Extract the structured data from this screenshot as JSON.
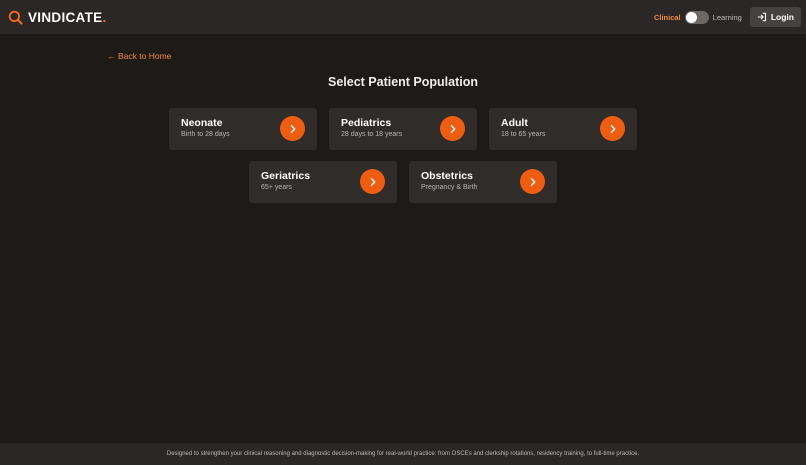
{
  "header": {
    "brand": "VINDICATE",
    "brand_suffix": ".",
    "mode_clinical": "Clinical",
    "mode_learning": "Learning",
    "toggle_state": "off",
    "login_label": "Login"
  },
  "nav": {
    "back_arrow": "←",
    "back_label": "Back to Home"
  },
  "main": {
    "title": "Select Patient Population",
    "cards": [
      {
        "title": "Neonate",
        "subtitle": "Birth to 28 days"
      },
      {
        "title": "Pediatrics",
        "subtitle": "28 days to 18 years"
      },
      {
        "title": "Adult",
        "subtitle": "18 to 65 years"
      },
      {
        "title": "Geriatrics",
        "subtitle": "65+ years"
      },
      {
        "title": "Obstetrics",
        "subtitle": "Pregnancy & Birth"
      }
    ]
  },
  "footer": {
    "text": "Designed to strengthen your clinical reasoning and diagnostic decision-making for real-world practice: from OSCEs and clerkship rotations, residency training, to full-time practice."
  },
  "icons": {
    "brand": "search-icon",
    "login": "login-icon",
    "card_action": "chevron-right-icon"
  },
  "colors": {
    "accent": "#ee5d12",
    "accent_text": "#f28a3a",
    "background": "#1e1a18",
    "header": "#2a2726",
    "card": "#302c2a"
  }
}
